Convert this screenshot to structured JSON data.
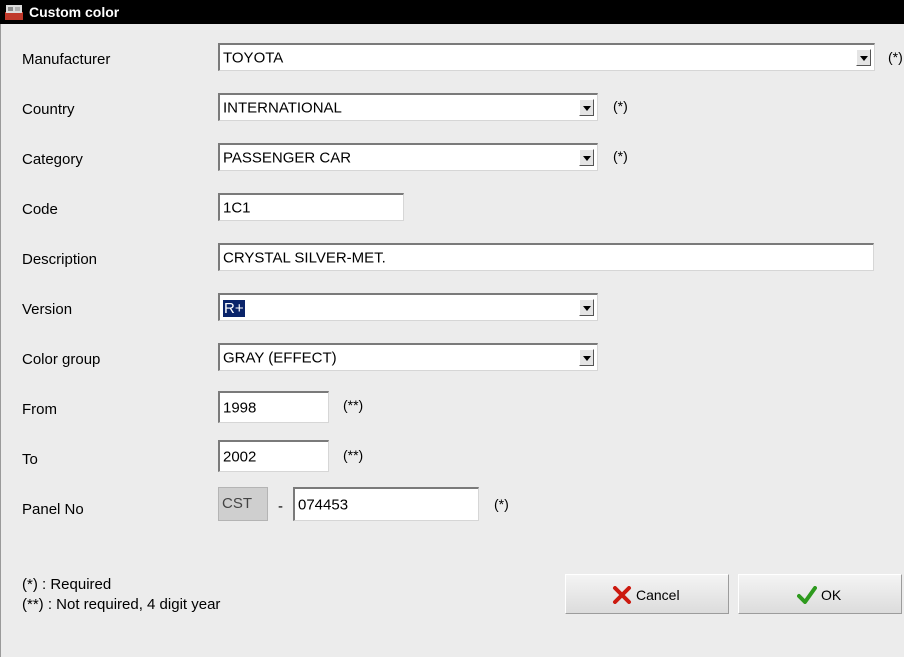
{
  "window": {
    "title": "Custom color"
  },
  "fields": {
    "manufacturer": {
      "label": "Manufacturer",
      "value": "TOYOTA",
      "mark": "(*)"
    },
    "country": {
      "label": "Country",
      "value": "INTERNATIONAL",
      "mark": "(*)"
    },
    "category": {
      "label": "Category",
      "value": "PASSENGER CAR",
      "mark": "(*)"
    },
    "code": {
      "label": "Code",
      "value": "1C1"
    },
    "description": {
      "label": "Description",
      "value": "CRYSTAL SILVER-MET."
    },
    "version": {
      "label": "Version",
      "value": "R+"
    },
    "color_group": {
      "label": "Color group",
      "value": "GRAY (EFFECT)"
    },
    "from": {
      "label": "From",
      "value": "1998",
      "mark": "(**)"
    },
    "to": {
      "label": "To",
      "value": "2002",
      "mark": "(**)"
    },
    "panel_no": {
      "label": "Panel No",
      "prefix": "CST",
      "separator": "-",
      "value": "074453",
      "mark": "(*)"
    }
  },
  "notes": {
    "required": "(*) : Required",
    "not_required": "(**) : Not required, 4 digit year"
  },
  "buttons": {
    "cancel": {
      "label": "Cancel",
      "icon": "red-x-icon"
    },
    "ok": {
      "label": "OK",
      "icon": "green-check-icon"
    }
  },
  "colors": {
    "titlebar": "#000000",
    "selection": "#0a246a",
    "background": "#ececec",
    "cancel_icon": "#cc1a10",
    "ok_icon": "#2e9a1e"
  }
}
